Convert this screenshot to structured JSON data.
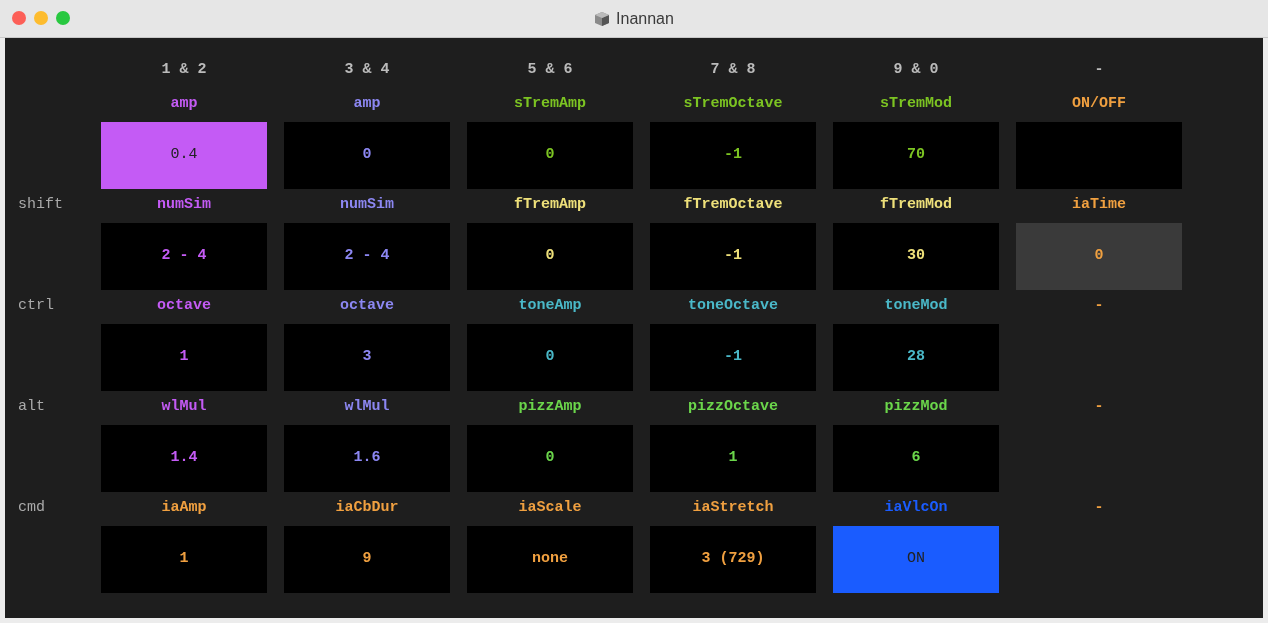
{
  "window": {
    "title": "Inannan"
  },
  "columns": [
    "1 & 2",
    "3 & 4",
    "5 & 6",
    "7 & 8",
    "9 & 0",
    "-"
  ],
  "rows": [
    {
      "cells": [
        {
          "label": "amp",
          "value": "0.4",
          "color": "#c45bf5",
          "kind": "filled"
        },
        {
          "label": "amp",
          "value": "0",
          "color": "#8c87f2",
          "kind": "box"
        },
        {
          "label": "sTremAmp",
          "value": "0",
          "color": "#7cc422",
          "kind": "box"
        },
        {
          "label": "sTremOctave",
          "value": "-1",
          "color": "#7cc422",
          "kind": "box"
        },
        {
          "label": "sTremMod",
          "value": "70",
          "color": "#7cc422",
          "kind": "box"
        },
        {
          "label": "ON/OFF",
          "color": "#f0a040",
          "kind": "box"
        }
      ]
    },
    {
      "modifier": "shift",
      "cells": [
        {
          "label": "numSim",
          "value": "2 - 4",
          "color": "#c45bf5",
          "kind": "box"
        },
        {
          "label": "numSim",
          "value": "2 - 4",
          "color": "#8c87f2",
          "kind": "box"
        },
        {
          "label": "fTremAmp",
          "value": "0",
          "color": "#eee07a",
          "kind": "box"
        },
        {
          "label": "fTremOctave",
          "value": "-1",
          "color": "#eee07a",
          "kind": "box"
        },
        {
          "label": "fTremMod",
          "value": "30",
          "color": "#eee07a",
          "kind": "box"
        },
        {
          "label": "iaTime",
          "value": "0",
          "color": "#f0a040",
          "kind": "dim"
        }
      ]
    },
    {
      "modifier": "ctrl",
      "cells": [
        {
          "label": "octave",
          "value": "1",
          "color": "#c45bf5",
          "kind": "box"
        },
        {
          "label": "octave",
          "value": "3",
          "color": "#8c87f2",
          "kind": "box"
        },
        {
          "label": "toneAmp",
          "value": "0",
          "color": "#4ab8c8",
          "kind": "box"
        },
        {
          "label": "toneOctave",
          "value": "-1",
          "color": "#4ab8c8",
          "kind": "box"
        },
        {
          "label": "toneMod",
          "value": "28",
          "color": "#4ab8c8",
          "kind": "box"
        },
        {
          "label": "-",
          "color": "#f0a040",
          "kind": "none"
        }
      ]
    },
    {
      "modifier": "alt",
      "cells": [
        {
          "label": "wlMul",
          "value": "1.4",
          "color": "#c45bf5",
          "kind": "box"
        },
        {
          "label": "wlMul",
          "value": "1.6",
          "color": "#8c87f2",
          "kind": "box"
        },
        {
          "label": "pizzAmp",
          "value": "0",
          "color": "#6bd64b",
          "kind": "box"
        },
        {
          "label": "pizzOctave",
          "value": "1",
          "color": "#6bd64b",
          "kind": "box"
        },
        {
          "label": "pizzMod",
          "value": "6",
          "color": "#6bd64b",
          "kind": "box"
        },
        {
          "label": "-",
          "color": "#f0a040",
          "kind": "none"
        }
      ]
    },
    {
      "modifier": "cmd",
      "cells": [
        {
          "label": "iaAmp",
          "value": "1",
          "color": "#f0a040",
          "kind": "box"
        },
        {
          "label": "iaCbDur",
          "value": "9",
          "color": "#f0a040",
          "kind": "box"
        },
        {
          "label": "iaScale",
          "value": "none",
          "color": "#f0a040",
          "kind": "box"
        },
        {
          "label": "iaStretch",
          "value": "3 (729)",
          "color": "#f0a040",
          "kind": "box"
        },
        {
          "label": "iaVlcOn",
          "value": "ON",
          "color": "#1a5cff",
          "kind": "filled"
        },
        {
          "label": "-",
          "color": "#f0a040",
          "kind": "none"
        }
      ]
    }
  ]
}
